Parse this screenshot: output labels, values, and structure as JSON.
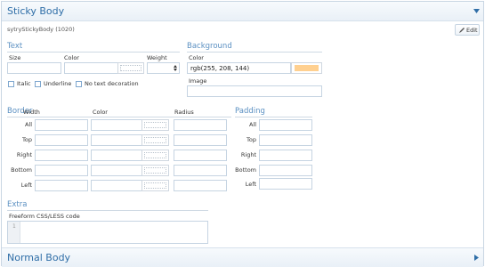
{
  "sticky": {
    "title": "Sticky Body",
    "subtitle": "sytryStickyBody (1020)",
    "edit_label": "Edit"
  },
  "text_section": {
    "heading": "Text",
    "size_label": "Size",
    "color_label": "Color",
    "weight_label": "Weight",
    "size_value": "",
    "color_value": "",
    "weight_value": "",
    "italic_label": "Italic",
    "underline_label": "Underline",
    "no_decoration_label": "No text decoration"
  },
  "background_section": {
    "heading": "Background",
    "color_label": "Color",
    "color_value": "rgb(255, 208, 144)",
    "swatch_color": "#ffd090",
    "image_label": "Image",
    "image_value": ""
  },
  "border_section": {
    "heading": "Border",
    "width_label": "Width",
    "color_label": "Color",
    "radius_label": "Radius",
    "rows": [
      {
        "label": "All"
      },
      {
        "label": "Top"
      },
      {
        "label": "Right"
      },
      {
        "label": "Bottom"
      },
      {
        "label": "Left"
      }
    ]
  },
  "padding_section": {
    "heading": "Padding",
    "rows": [
      {
        "label": "All"
      },
      {
        "label": "Top"
      },
      {
        "label": "Right"
      },
      {
        "label": "Bottom"
      },
      {
        "label": "Left"
      }
    ]
  },
  "extra_section": {
    "heading": "Extra",
    "code_label": "Freeform CSS/LESS code",
    "line_number": "1",
    "code_value": ""
  },
  "normal": {
    "title": "Normal Body"
  },
  "colors": {
    "accent": "#5b90c2",
    "title": "#2f6ea7",
    "field_border": "#c6d4e2"
  }
}
